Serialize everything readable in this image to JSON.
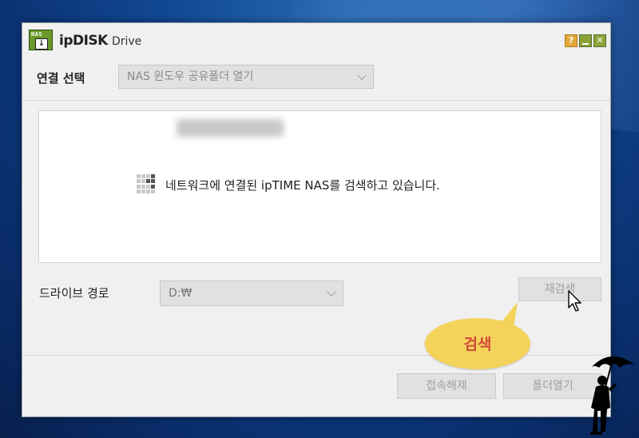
{
  "window": {
    "title_brand": "ipDISK",
    "title_suffix": "Drive",
    "logo_tag": "NAS",
    "logo_glyph": "↓",
    "controls": {
      "help": "?",
      "close": "✕"
    }
  },
  "connection": {
    "label": "연결 선택",
    "selected": "NAS 윈도우 공유폴더 열기"
  },
  "status": {
    "message": "네트워크에 연결된 ipTIME NAS를 검색하고 있습니다."
  },
  "drive": {
    "label": "드라이브 경로",
    "selected": "D:₩"
  },
  "buttons": {
    "research": "재검색",
    "disconnect": "접속해제",
    "open_folder": "폴더열기"
  },
  "annotation": {
    "bubble_text": "검색"
  },
  "colors": {
    "bubble": "#f4d35a",
    "bubble_text": "#d24a3a",
    "logo_green": "#6a9a2c"
  }
}
